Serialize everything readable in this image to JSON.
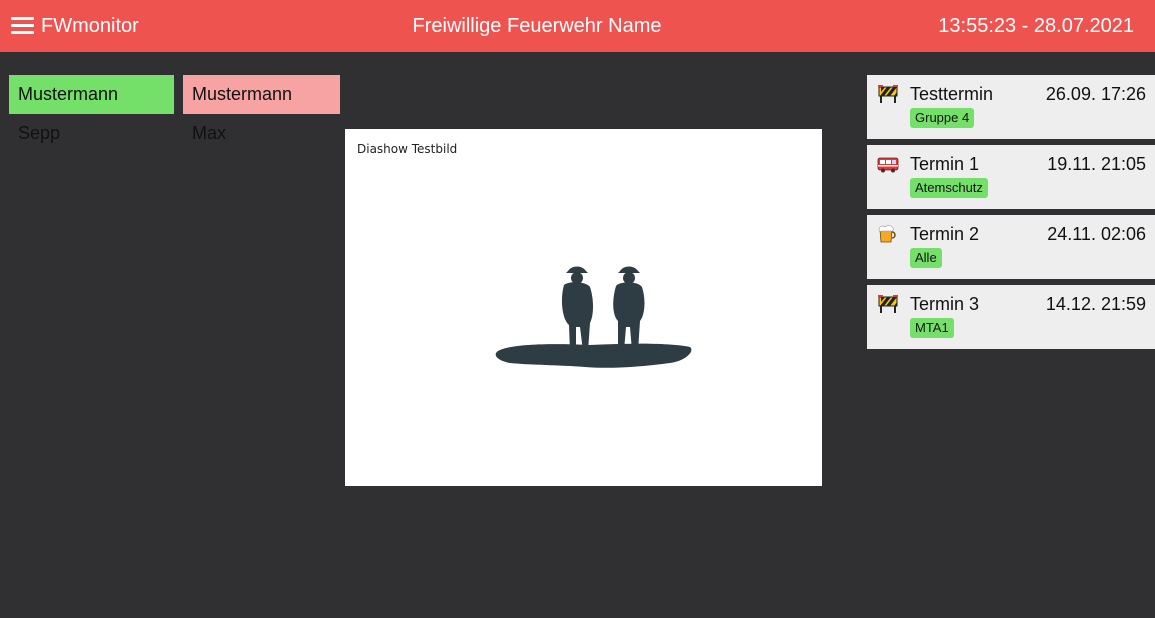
{
  "header": {
    "app_title": "FWmonitor",
    "org_name": "Freiwillige Feuerwehr Name",
    "clock": "13:55:23 - 28.07.2021"
  },
  "people": [
    {
      "name": "Mustermann Sepp",
      "status": "available",
      "color": "#74e06a"
    },
    {
      "name": "Mustermann Max",
      "status": "unavailable",
      "color": "#f8a3a3"
    }
  ],
  "slideshow": {
    "caption": "Diashow Testbild",
    "image": "firefighters-silhouette"
  },
  "events": [
    {
      "title": "Testtermin",
      "date": "26.09. 17:26",
      "group": "Gruppe 4",
      "icon": "construction-barrier-icon"
    },
    {
      "title": "Termin 1",
      "date": "19.11. 21:05",
      "group": "Atemschutz",
      "icon": "fire-engine-icon"
    },
    {
      "title": "Termin 2",
      "date": "24.11. 02:06",
      "group": "Alle",
      "icon": "beer-mug-icon"
    },
    {
      "title": "Termin 3",
      "date": "14.12. 21:59",
      "group": "MTA1",
      "icon": "construction-barrier-icon"
    }
  ],
  "colors": {
    "header": "#ef5350",
    "background": "#303032",
    "tag": "#74e06a",
    "event_card": "#eeeeee"
  }
}
